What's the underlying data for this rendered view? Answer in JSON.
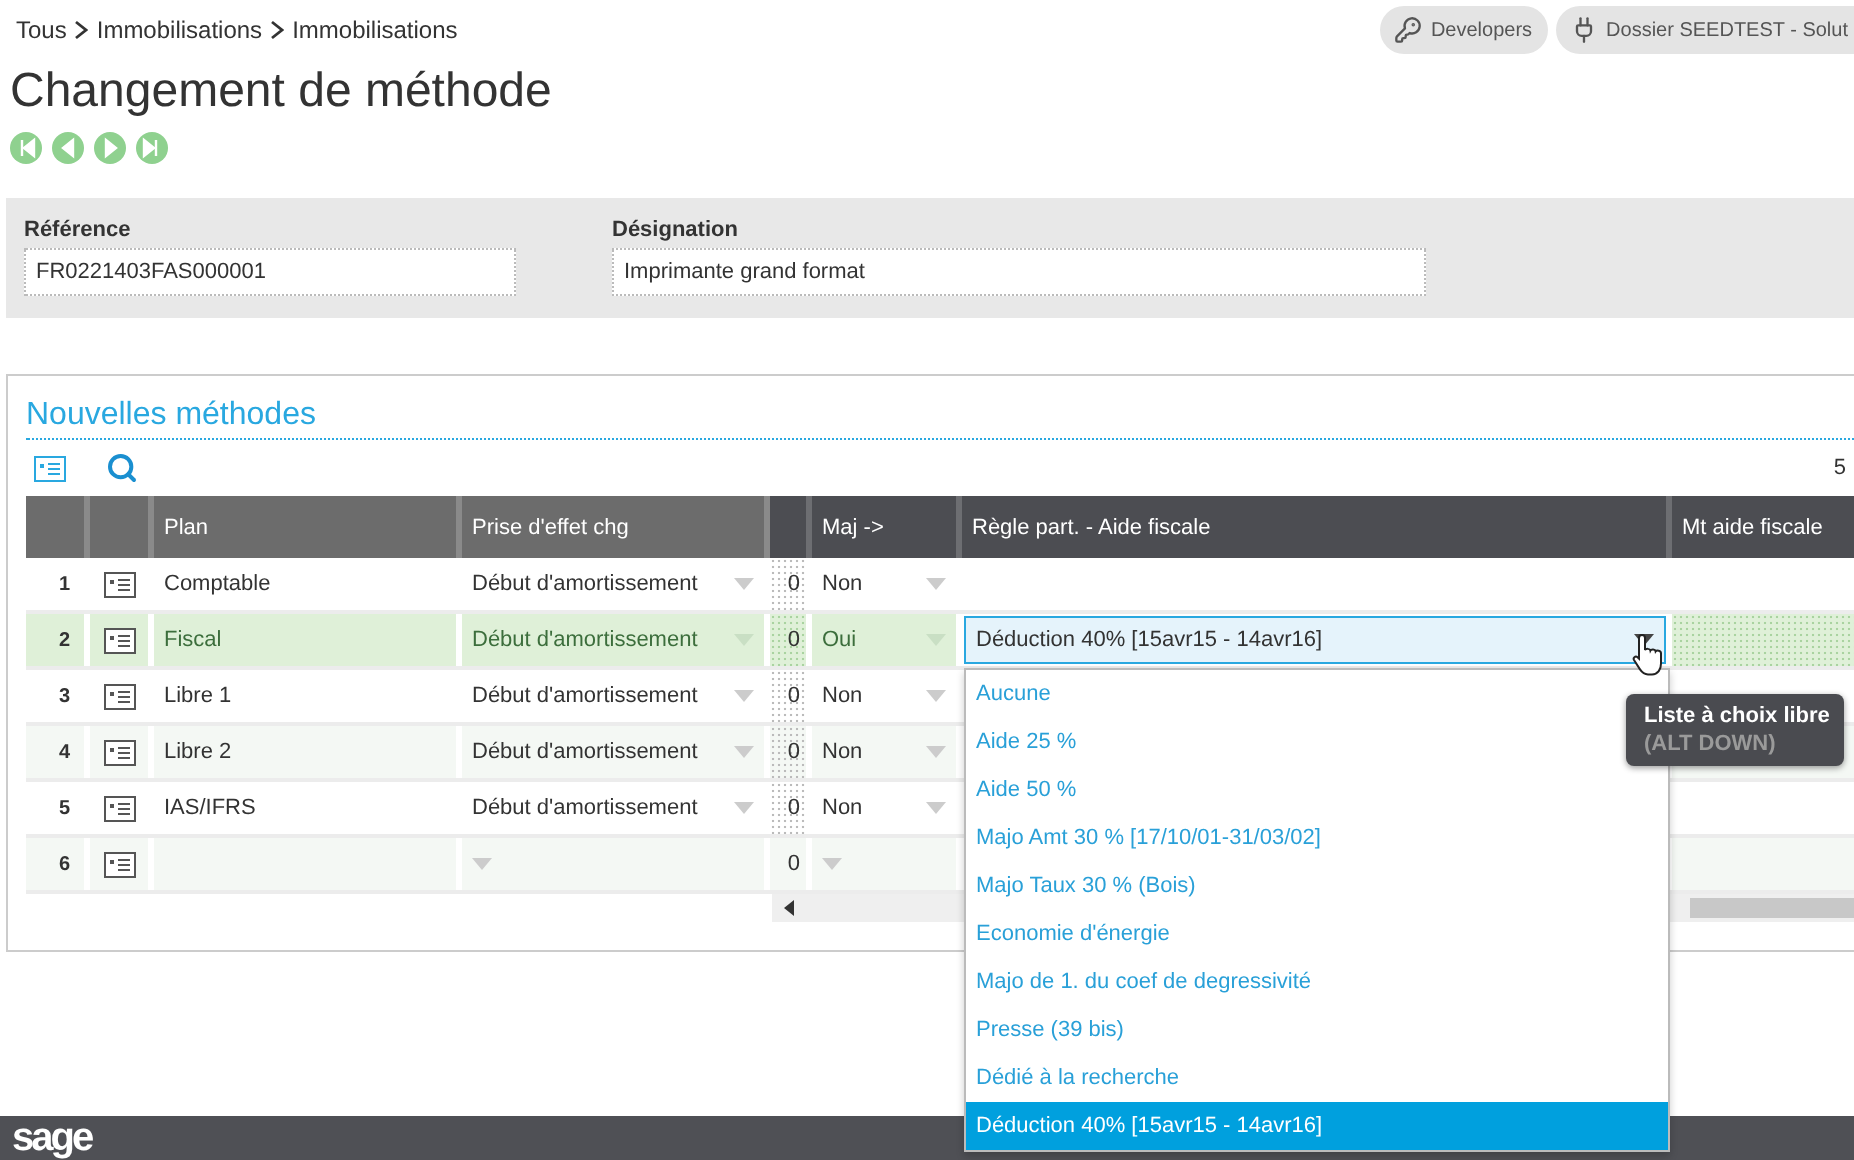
{
  "breadcrumb": [
    "Tous",
    "Immobilisations",
    "Immobilisations"
  ],
  "top_buttons": [
    {
      "label": "Developers",
      "kind": "key"
    },
    {
      "label": "Dossier SEEDTEST - Solut",
      "kind": "plug"
    }
  ],
  "title": "Changement de méthode",
  "record_nav": [
    {
      "kind": "first"
    },
    {
      "kind": "previous"
    },
    {
      "kind": "next"
    },
    {
      "kind": "last"
    }
  ],
  "header_fields": [
    {
      "label": "Référence",
      "value": "FR0221403FAS000001"
    },
    {
      "label": "Désignation",
      "value": "Imprimante grand format"
    }
  ],
  "section": {
    "title": "Nouvelles méthodes",
    "count": "5",
    "table": {
      "columns": [
        "Plan",
        "Prise d'effet chg",
        "Maj ->",
        "Règle part. - Aide fiscale",
        "Mt aide fiscale"
      ],
      "rows": [
        {
          "number": "1",
          "plan": "Comptable",
          "effect": "Début d'amortissement",
          "column_5": "0",
          "update": "Non",
          "selected": false
        },
        {
          "number": "2",
          "plan": "Fiscal",
          "effect": "Début d'amortissement",
          "column_5": "0",
          "update": "Oui",
          "selected": true,
          "rule": "Déduction 40% [15avr15 - 14avr16]",
          "rule_options": [
            {
              "label": "Aucune",
              "selected": false
            },
            {
              "label": "Aide 25 %",
              "selected": false
            },
            {
              "label": "Aide 50 %",
              "selected": false
            },
            {
              "label": "Majo Amt 30 % [17/10/01-31/03/02]",
              "selected": false
            },
            {
              "label": "Majo Taux 30 % (Bois)",
              "selected": false
            },
            {
              "label": "Economie d'énergie",
              "selected": false
            },
            {
              "label": "Majo de 1. du coef de degressivité",
              "selected": false
            },
            {
              "label": "Presse (39 bis)",
              "selected": false
            },
            {
              "label": "Dédié à la recherche",
              "selected": false
            },
            {
              "label": "Déduction 40% [15avr15 - 14avr16]",
              "selected": true
            }
          ]
        },
        {
          "number": "3",
          "plan": "Libre 1",
          "effect": "Début d'amortissement",
          "column_5": "0",
          "update": "Non",
          "selected": false
        },
        {
          "number": "4",
          "plan": "Libre 2",
          "effect": "Début d'amortissement",
          "column_5": "0",
          "update": "Non",
          "selected": false
        },
        {
          "number": "5",
          "plan": "IAS/IFRS",
          "effect": "Début d'amortissement",
          "column_5": "0",
          "update": "Non",
          "selected": false
        },
        {
          "number": "6",
          "column_5": "0",
          "selected": false
        }
      ]
    }
  },
  "tooltip": {
    "title": "Liste à choix libre",
    "shortcut": "(ALT DOWN)"
  },
  "footer": {
    "logo": "sage"
  }
}
